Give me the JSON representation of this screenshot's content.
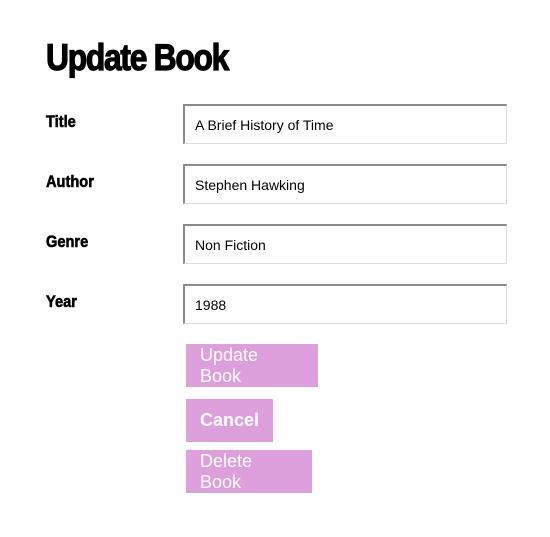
{
  "heading": "Update Book",
  "form": {
    "fields": [
      {
        "label": "Title",
        "value": "A Brief History of Time"
      },
      {
        "label": "Author",
        "value": "Stephen Hawking"
      },
      {
        "label": "Genre",
        "value": "Non Fiction"
      },
      {
        "label": "Year",
        "value": "1988"
      }
    ],
    "buttons": {
      "update": "Update Book",
      "cancel": "Cancel",
      "delete": "Delete Book"
    }
  },
  "colors": {
    "button_bg": "#dda0dd",
    "button_text": "#ffffff"
  }
}
